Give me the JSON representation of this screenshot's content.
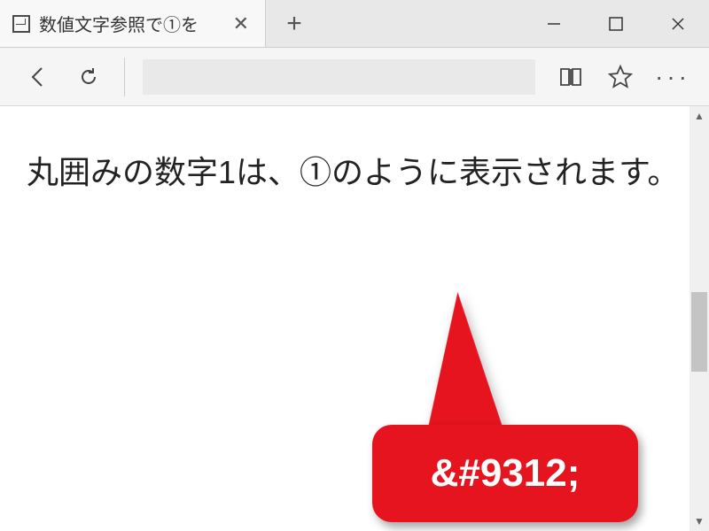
{
  "tab": {
    "title": "数値文字参照で①を"
  },
  "content": {
    "body_text": "丸囲みの数字1は、①のように表示されます。"
  },
  "callout": {
    "code": "&#9312;"
  }
}
